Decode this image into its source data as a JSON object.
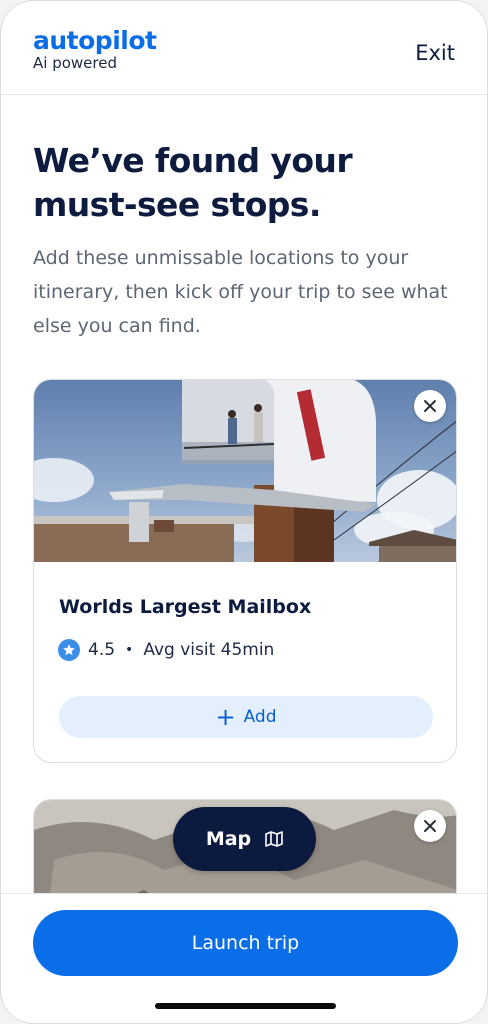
{
  "header": {
    "brand_name": "autopilot",
    "brand_tagline": "Ai powered",
    "exit_label": "Exit"
  },
  "intro": {
    "title": "We’ve found your must-see stops.",
    "description": "Add these unmissable locations to your itinerary, then kick off your trip to see what else you can find."
  },
  "cards": [
    {
      "name": "Worlds Largest Mailbox",
      "rating": "4.5",
      "separator": "•",
      "visit": "Avg visit 45min",
      "add_label": "Add",
      "add_glyph": "+"
    }
  ],
  "map_button": {
    "label": "Map",
    "icon": "map-icon"
  },
  "footer": {
    "launch_label": "Launch trip"
  },
  "colors": {
    "brand_blue": "#0a6de6",
    "navy": "#0c1a3f",
    "add_bg": "#e3effc",
    "rating_badge": "#3a8ee8"
  }
}
